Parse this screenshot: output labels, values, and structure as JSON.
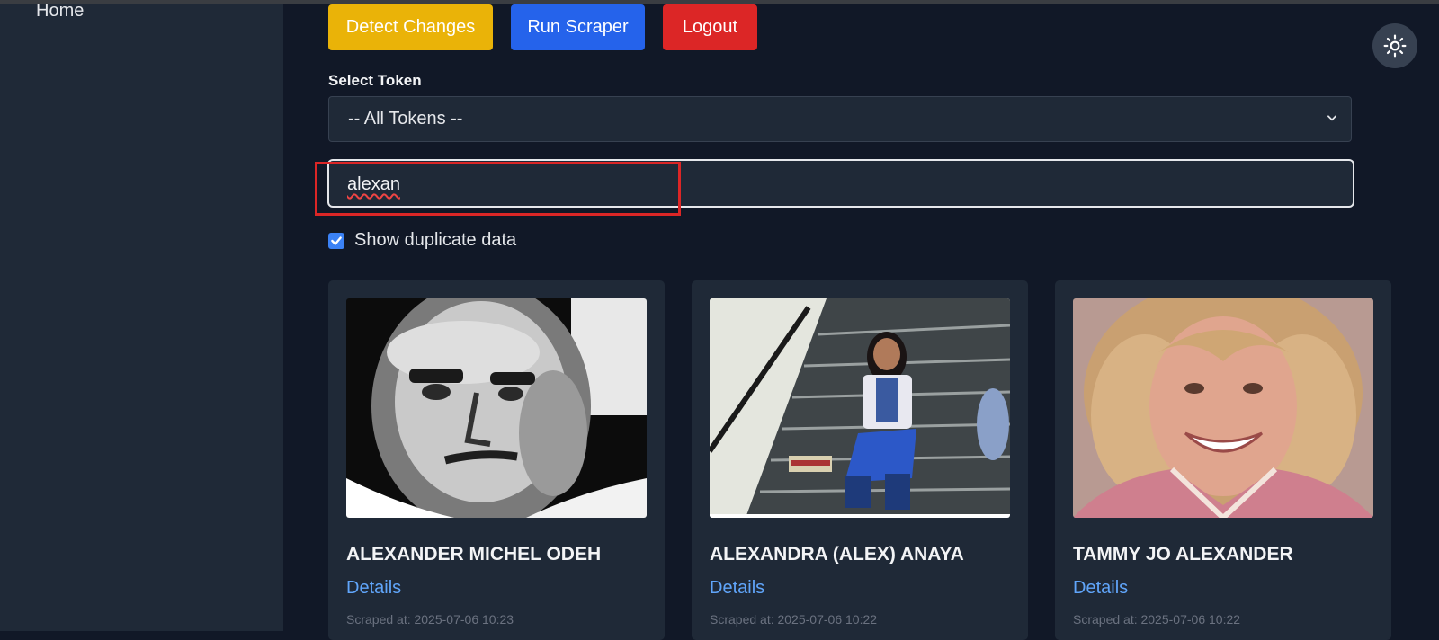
{
  "sidebar": {
    "home_label": "Home"
  },
  "toolbar": {
    "detect_label": "Detect Changes",
    "run_label": "Run Scraper",
    "logout_label": "Logout"
  },
  "token": {
    "label": "Select Token",
    "selected": "-- All Tokens --"
  },
  "search": {
    "value": "alexan"
  },
  "duplicate": {
    "label": "Show duplicate data",
    "checked": true
  },
  "cards": [
    {
      "name": "ALEXANDER MICHEL ODEH",
      "details": "Details",
      "scraped": "Scraped at: 2025-07-06 10:23"
    },
    {
      "name": "ALEXANDRA (ALEX) ANAYA",
      "details": "Details",
      "scraped": "Scraped at: 2025-07-06 10:22"
    },
    {
      "name": "TAMMY JO ALEXANDER",
      "details": "Details",
      "scraped": "Scraped at: 2025-07-06 10:22"
    }
  ],
  "colors": {
    "background": "#111827",
    "sidebar": "#1f2937",
    "detect": "#eab308",
    "run": "#2563eb",
    "logout": "#dc2626",
    "link": "#60a5fa"
  },
  "icons": {
    "theme": "sun-icon",
    "select": "chevron-down-icon",
    "check": "check-icon"
  }
}
